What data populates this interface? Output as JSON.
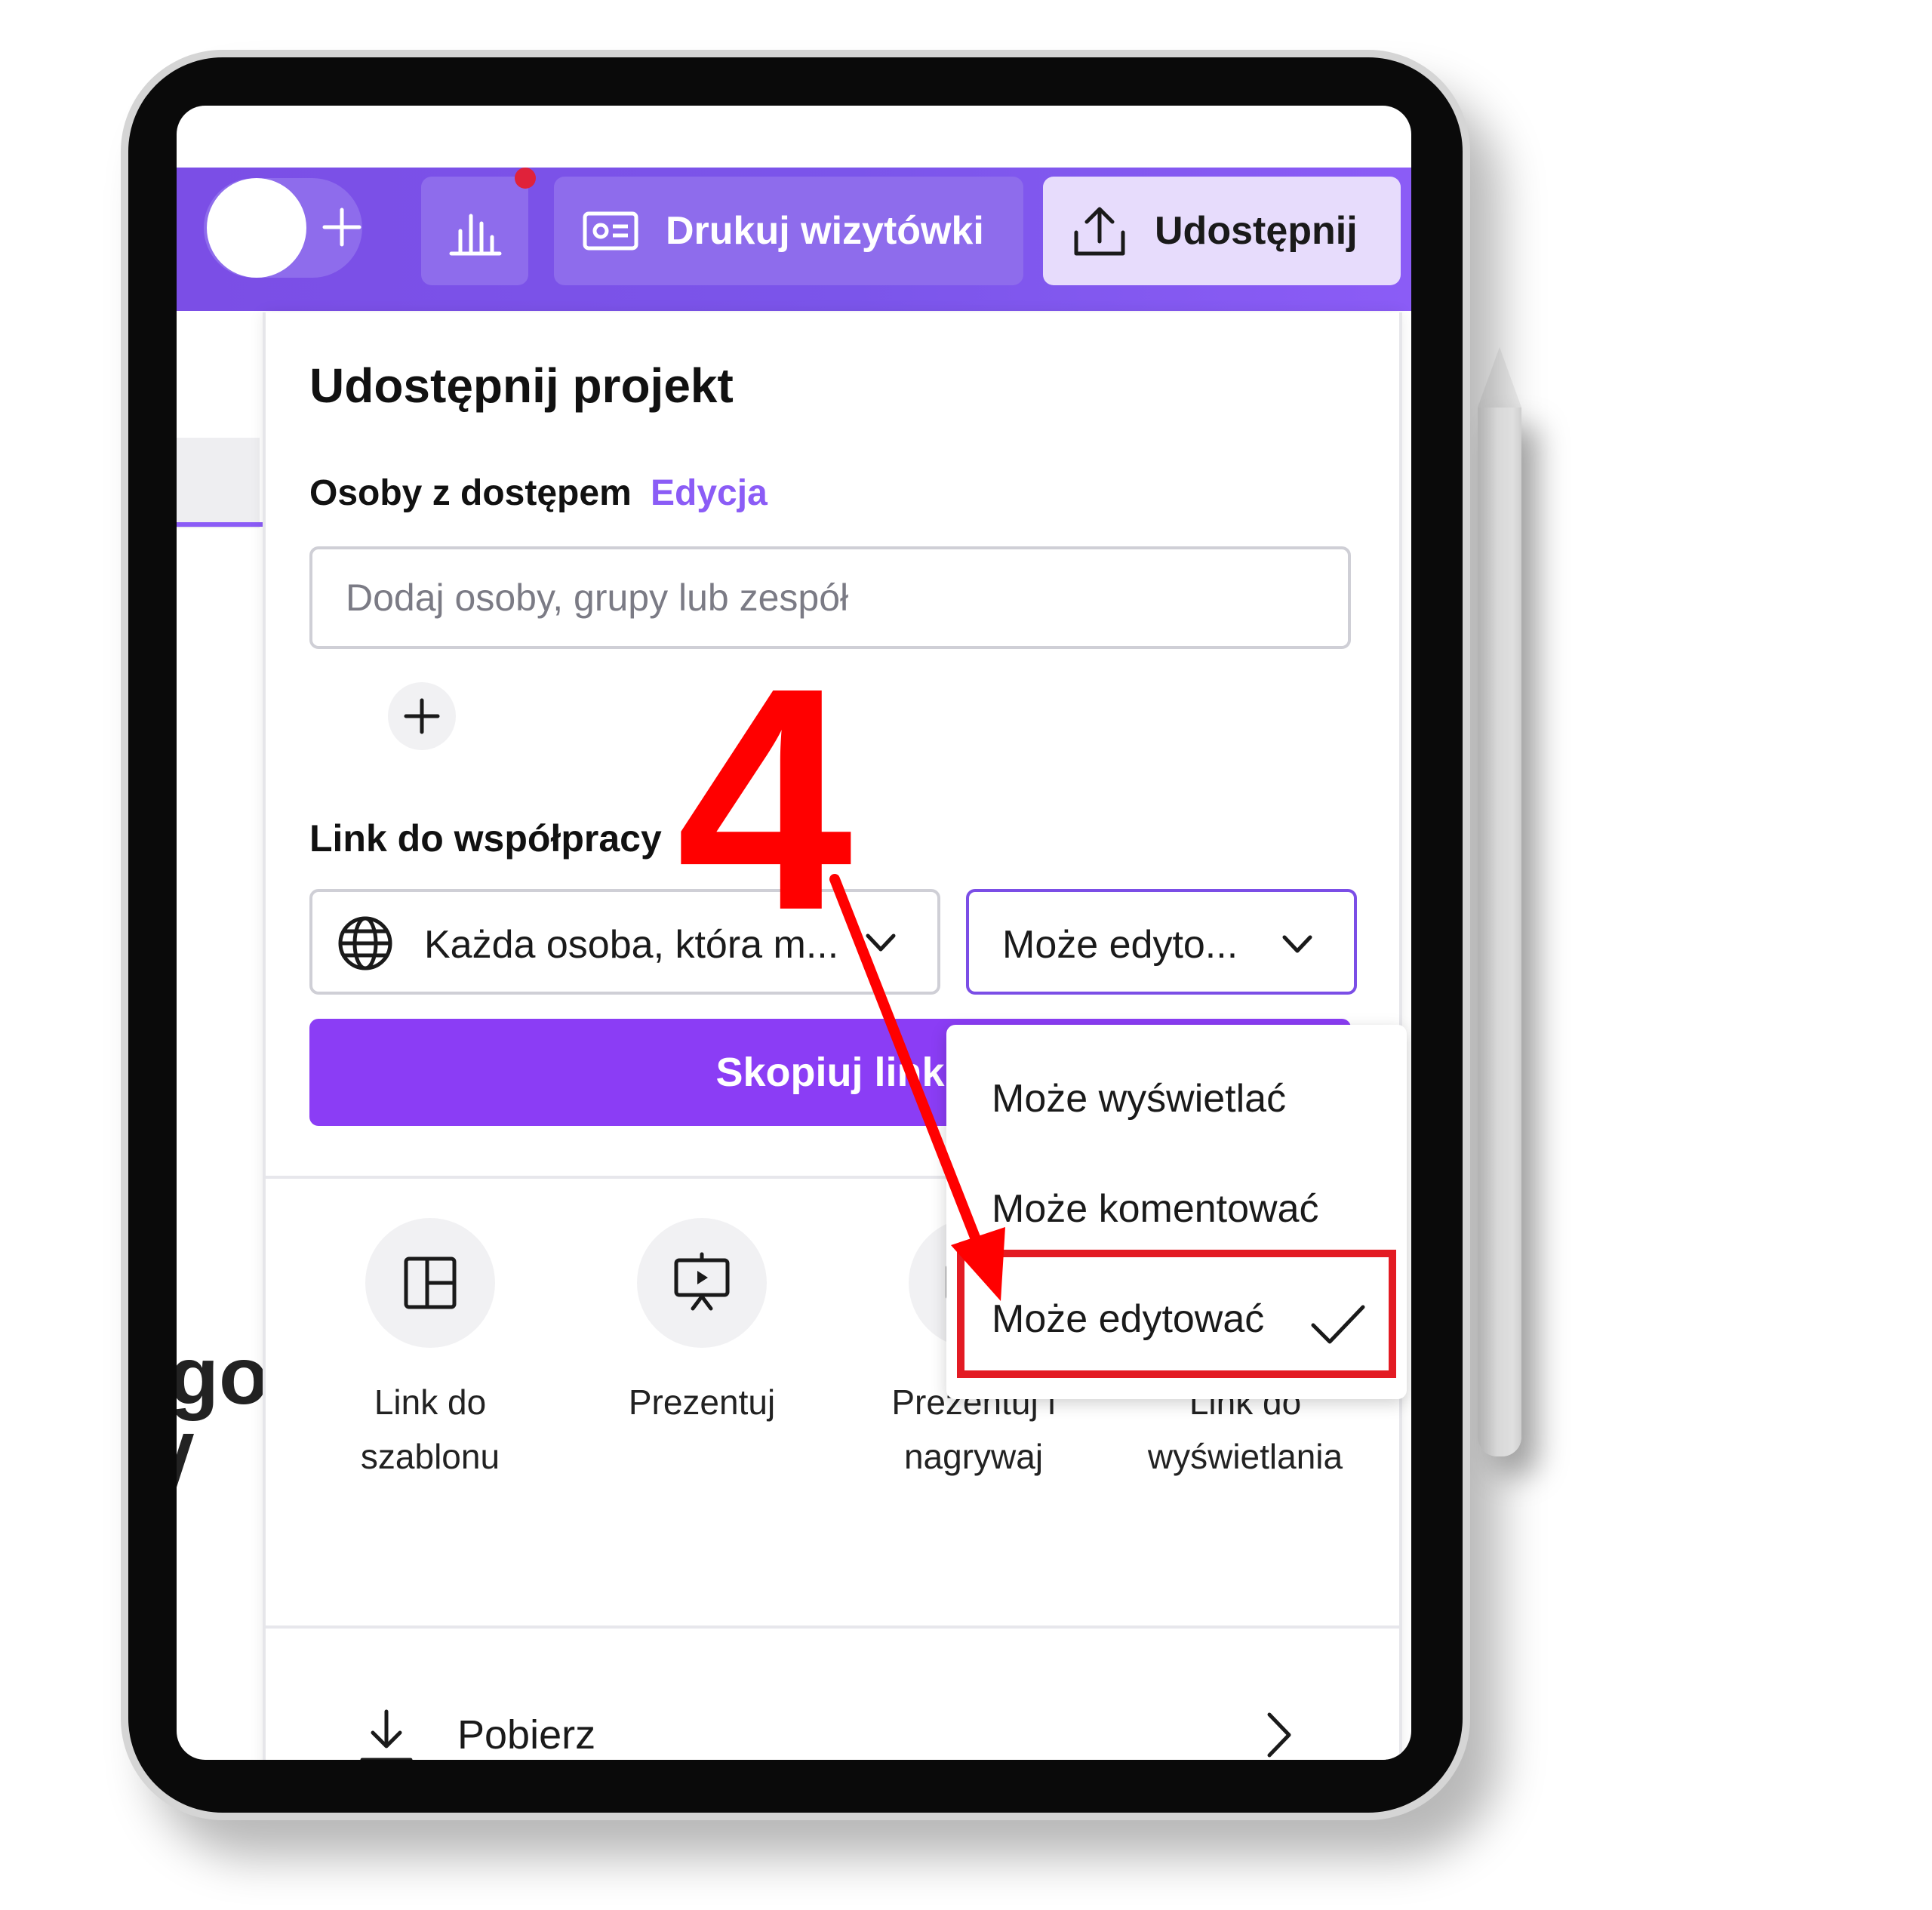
{
  "topbar": {
    "print_label": "Drukuj wizytówki",
    "share_label": "Udostępnij",
    "accent_color": "#7b4ee6",
    "notification_color": "#e0223a"
  },
  "background": {
    "partial_text": "go"
  },
  "share_panel": {
    "title": "Udostępnij projekt",
    "access_label": "Osoby z dostępem",
    "access_edit_link": "Edycja",
    "add_people_placeholder": "Dodaj osoby, grupy lub zespół",
    "collab_link_label": "Link do współpracy",
    "who_select_value": "Każda osoba, która m...",
    "permission_select_value": "Może edyto...",
    "copy_button_label": "Skopiuj link",
    "options": [
      {
        "label": "Link do szablonu",
        "icon": "template-icon"
      },
      {
        "label": "Prezentuj",
        "icon": "present-icon"
      },
      {
        "label": "Prezentuj i nagrywaj",
        "icon": "present-record-icon"
      },
      {
        "label": "Link do wyświetlania",
        "icon": "view-link-icon"
      }
    ],
    "download_label": "Pobierz"
  },
  "permission_dropdown": {
    "items": [
      "Może wyświetlać",
      "Może komentować",
      "Może edytować"
    ],
    "selected": "Może edytować",
    "highlight_color": "#e31b23"
  },
  "annotation": {
    "step_number": "4",
    "color": "#ff0000"
  }
}
